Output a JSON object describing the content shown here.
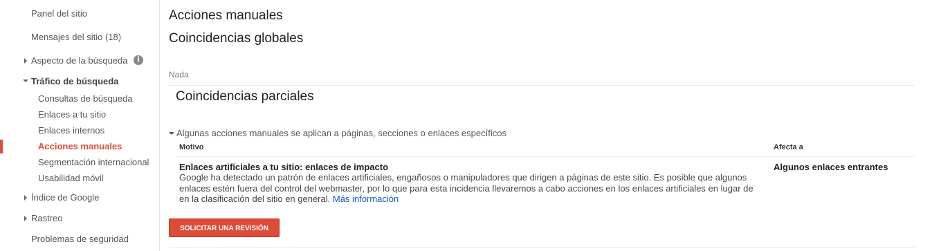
{
  "sidebar": {
    "items": [
      {
        "label": "Panel del sitio"
      },
      {
        "label": "Mensajes del sitio (18)"
      },
      {
        "label": "Aspecto de la búsqueda"
      },
      {
        "label": "Tráfico de búsqueda"
      },
      {
        "label": "Índice de Google"
      },
      {
        "label": "Rastreo"
      },
      {
        "label": "Problemas de seguridad"
      }
    ],
    "subitems": [
      {
        "label": "Consultas de búsqueda"
      },
      {
        "label": "Enlaces a tu sitio"
      },
      {
        "label": "Enlaces internos"
      },
      {
        "label": "Acciones manuales",
        "active": true
      },
      {
        "label": "Segmentación internacional"
      },
      {
        "label": "Usabilidad móvil"
      }
    ],
    "info_icon": "info-icon",
    "accent_color": "#dd4b39"
  },
  "main": {
    "title": "Acciones manuales",
    "global_heading": "Coincidencias globales",
    "global_none": "Nada",
    "partial_heading": "Coincidencias parciales",
    "partial_note": "Algunas acciones manuales se aplican a páginas, secciones o enlaces específicos",
    "table": {
      "headers": {
        "reason": "Motivo",
        "affects": "Afecta a"
      },
      "rows": [
        {
          "title": "Enlaces artificiales a tu sitio: enlaces de impacto",
          "description": "Google ha detectado un patrón de enlaces artificiales, engañosos o manipuladores que dirigen a páginas de este sitio. Es posible que algunos enlaces estén fuera del control del webmaster, por lo que para esta incidencia llevaremos a cabo acciones en los enlaces artificiales en lugar de en la clasificación del sitio en general.",
          "link": "Más información",
          "affects": "Algunos enlaces entrantes"
        }
      ]
    },
    "review_button": "SOLICITAR UNA REVISIÓN"
  }
}
